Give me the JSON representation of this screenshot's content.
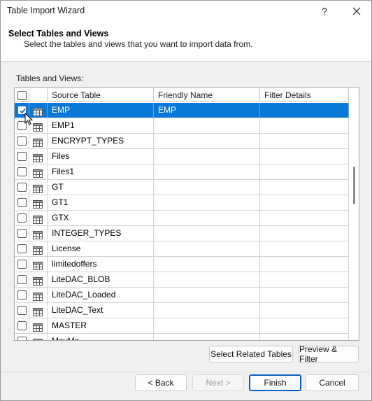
{
  "window": {
    "title": "Table Import Wizard",
    "help_glyph": "?",
    "close_glyph": "✕"
  },
  "header": {
    "title": "Select Tables and Views",
    "subtitle": "Select the tables and views that you want to import data from."
  },
  "grid": {
    "label": "Tables and Views:",
    "columns": [
      "Source Table",
      "Friendly Name",
      "Filter Details"
    ],
    "rows": [
      {
        "source": "EMP",
        "friendly": "EMP",
        "filter": "",
        "checked": true,
        "selected": true
      },
      {
        "source": "EMP1",
        "friendly": "",
        "filter": "",
        "checked": false
      },
      {
        "source": "ENCRYPT_TYPES",
        "friendly": "",
        "filter": "",
        "checked": false
      },
      {
        "source": "Files",
        "friendly": "",
        "filter": "",
        "checked": false
      },
      {
        "source": "Files1",
        "friendly": "",
        "filter": "",
        "checked": false
      },
      {
        "source": "GT",
        "friendly": "",
        "filter": "",
        "checked": false
      },
      {
        "source": "GT1",
        "friendly": "",
        "filter": "",
        "checked": false
      },
      {
        "source": "GTX",
        "friendly": "",
        "filter": "",
        "checked": false
      },
      {
        "source": "INTEGER_TYPES",
        "friendly": "",
        "filter": "",
        "checked": false
      },
      {
        "source": "License",
        "friendly": "",
        "filter": "",
        "checked": false
      },
      {
        "source": "limitedoffers",
        "friendly": "",
        "filter": "",
        "checked": false
      },
      {
        "source": "LiteDAC_BLOB",
        "friendly": "",
        "filter": "",
        "checked": false
      },
      {
        "source": "LiteDAC_Loaded",
        "friendly": "",
        "filter": "",
        "checked": false
      },
      {
        "source": "LiteDAC_Text",
        "friendly": "",
        "filter": "",
        "checked": false
      },
      {
        "source": "MASTER",
        "friendly": "",
        "filter": "",
        "checked": false
      },
      {
        "source": "MovMo",
        "friendly": "",
        "filter": "",
        "checked": false
      }
    ]
  },
  "buttons": {
    "select_related": "Select Related Tables",
    "preview_filter": "Preview & Filter",
    "back": "< Back",
    "next": "Next >",
    "finish": "Finish",
    "cancel": "Cancel"
  },
  "colors": {
    "selection": "#0a78d7",
    "primary_border": "#0a5fc4"
  }
}
